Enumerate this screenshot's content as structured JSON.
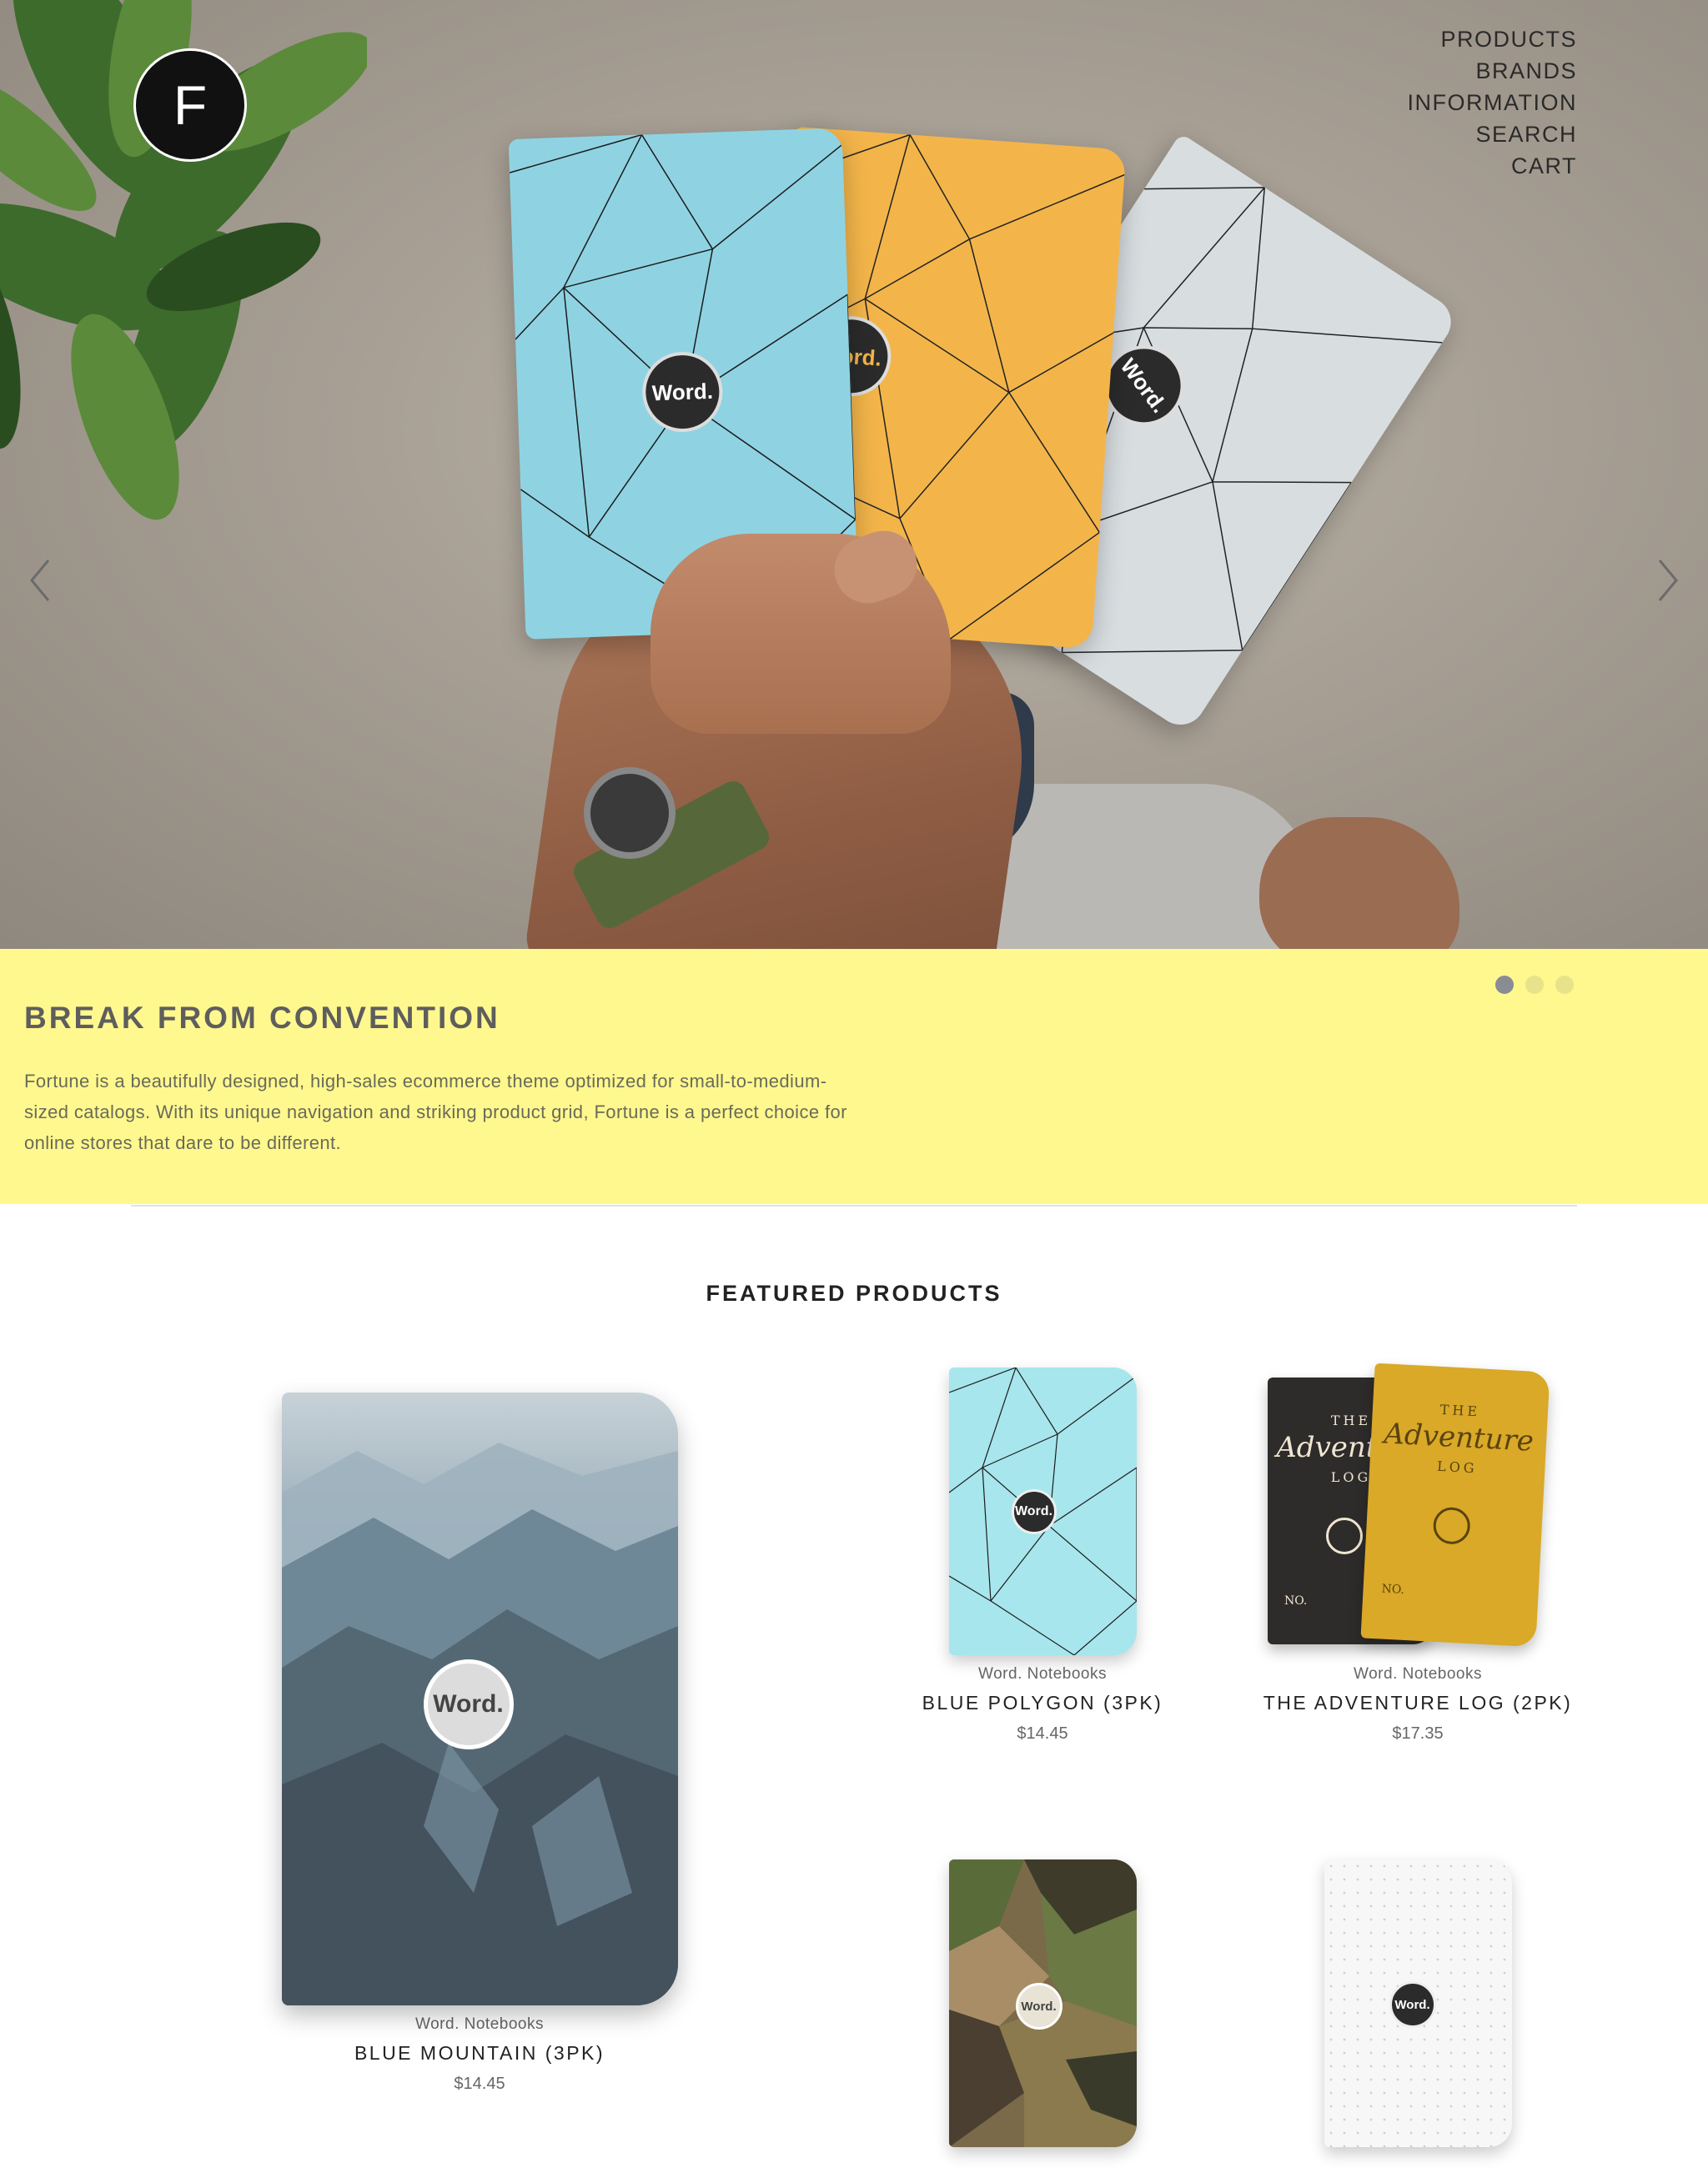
{
  "store": {
    "logo_letter": "F"
  },
  "nav": {
    "items": [
      "PRODUCTS",
      "BRANDS",
      "INFORMATION",
      "SEARCH",
      "CART"
    ]
  },
  "hero": {
    "notebook_badge": "Word.",
    "prev_icon": "chevron-left-icon",
    "next_icon": "chevron-right-icon"
  },
  "slideshow": {
    "title": "BREAK FROM CONVENTION",
    "description": "Fortune is a beautifully designed, high-sales ecommerce theme optimized for small-to-medium-sized catalogs. With its unique navigation and striking product grid, Fortune is a perfect choice for online stores that dare to be different.",
    "slide_count": 3,
    "active_slide": 1,
    "caption_bg": "#fff88e"
  },
  "featured": {
    "title": "FEATURED PRODUCTS",
    "products": [
      {
        "brand": "Word. Notebooks",
        "name": "BLUE MOUNTAIN (3PK)",
        "price": "$14.45",
        "badge": "Word."
      },
      {
        "brand": "Word. Notebooks",
        "name": "BLUE POLYGON (3PK)",
        "price": "$14.45",
        "badge": "Word."
      },
      {
        "brand": "Word. Notebooks",
        "name": "THE ADVENTURE LOG (2PK)",
        "price": "$17.35",
        "badge_the": "THE",
        "badge_title": "Adventure",
        "badge_log": "LOG",
        "badge_no": "NO."
      },
      {
        "badge": "Word."
      },
      {
        "badge": "Word."
      }
    ]
  }
}
